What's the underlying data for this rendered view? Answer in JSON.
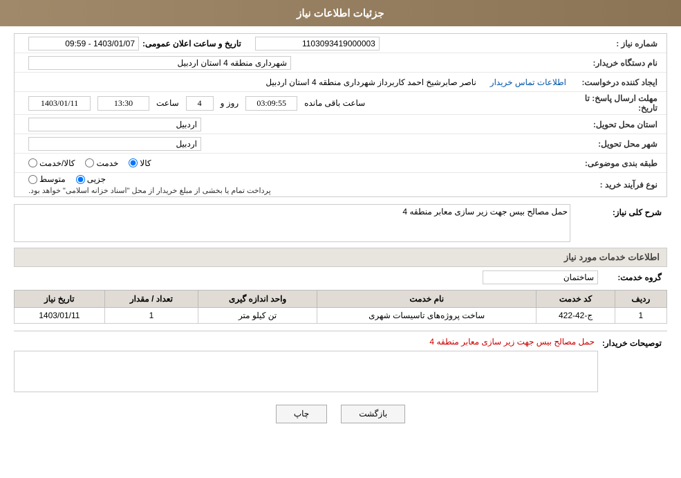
{
  "header": {
    "title": "جزئیات اطلاعات نیاز"
  },
  "fields": {
    "need_number_label": "شماره نیاز :",
    "need_number_value": "1103093419000003",
    "announce_date_label": "تاریخ و ساعت اعلان عمومی:",
    "announce_date_value": "1403/01/07 - 09:59",
    "buyer_org_label": "نام دستگاه خریدار:",
    "buyer_org_value": "شهرداری منطقه 4 استان اردبیل",
    "requester_label": "ایجاد کننده درخواست:",
    "requester_value": "ناصر صابرشیخ احمد کاربرداز شهرداری منطقه 4 استان اردبیل",
    "buyer_contact_link": "اطلاعات تماس خریدار",
    "deadline_label": "مهلت ارسال پاسخ: تا تاریخ:",
    "deadline_date": "1403/01/11",
    "deadline_time_label": "ساعت",
    "deadline_time": "13:30",
    "remaining_days_label": "روز و",
    "remaining_days": "4",
    "remaining_time": "03:09:55",
    "remaining_suffix": "ساعت باقی مانده",
    "province_label": "استان محل تحویل:",
    "province_value": "اردبیل",
    "city_label": "شهر محل تحویل:",
    "city_value": "اردبیل",
    "category_label": "طبقه بندی موضوعی:",
    "category_kala": "کالا",
    "category_khadamat": "خدمت",
    "category_kala_khadamat": "کالا/خدمت",
    "process_label": "نوع فرآیند خرید :",
    "process_jazii": "جزیی",
    "process_motavaset": "متوسط",
    "process_desc": "پرداخت تمام یا بخشی از مبلغ خریدار از محل \"اسناد خزانه اسلامی\" خواهد بود.",
    "need_description_label": "شرح کلی نیاز:",
    "need_description_value": "حمل مصالح بیس جهت زیر سازی معابر منطقه 4",
    "service_info_title": "اطلاعات خدمات مورد نیاز",
    "service_group_label": "گروه خدمت:",
    "service_group_value": "ساختمان",
    "table": {
      "headers": [
        "ردیف",
        "کد خدمت",
        "نام خدمت",
        "واحد اندازه گیری",
        "تعداد / مقدار",
        "تاریخ نیاز"
      ],
      "rows": [
        {
          "row": "1",
          "code": "ج-42-422",
          "name": "ساخت پروژه‌های تاسیسات شهری",
          "unit": "تن کیلو متر",
          "quantity": "1",
          "date": "1403/01/11"
        }
      ]
    },
    "buyer_description_label": "توصیحات خریدار:",
    "buyer_description_text": "حمل مصالح بیس جهت زیر سازی معابر منطقه 4",
    "buttons": {
      "print": "چاپ",
      "back": "بازگشت"
    }
  }
}
